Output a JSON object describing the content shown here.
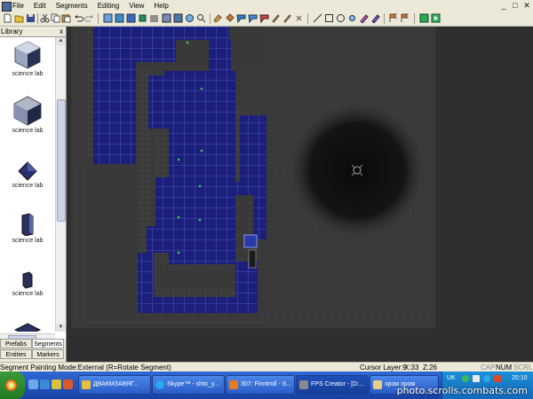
{
  "menu": {
    "items": [
      "File",
      "Edit",
      "Segments",
      "Editing",
      "View",
      "Help"
    ]
  },
  "window_controls": {
    "minimize": "_",
    "maximize": "□",
    "close": "✕"
  },
  "library": {
    "title": "Library",
    "close": "x",
    "items": [
      {
        "label": "science lab"
      },
      {
        "label": "science lab"
      },
      {
        "label": "science lab"
      },
      {
        "label": "science lab"
      },
      {
        "label": "science lab"
      },
      {
        "label": ""
      }
    ],
    "tabs": [
      "Prefabs",
      "Segments",
      "Entities",
      "Markers"
    ]
  },
  "status": {
    "mode": "Segment Painting Mode:External (R=Rotate Segment)",
    "cursor_layer": "Cursor Layer:9",
    "x": "X:33",
    "z": "Z:26",
    "cap": "CAP",
    "num": "NUM",
    "scrl": "SCRL"
  },
  "taskbar": {
    "tasks": [
      {
        "label": "ДВАКМЗАВЯГ..."
      },
      {
        "label": "Skype™ - shto_y..."
      },
      {
        "label": "307: Finntroll - S..."
      },
      {
        "label": "FPS Creator - [D:..."
      },
      {
        "label": "хром эром"
      }
    ],
    "lang": "UK",
    "clock": "20:10"
  },
  "watermark": "photo.scrolls.combats.com",
  "colors": {
    "chrome": "#ece9d8",
    "viewport_bg": "#2f2f2f",
    "grid_area": "#3a3a3a",
    "segment_blue": "#1c1f7a",
    "taskbar": "#245edb"
  }
}
